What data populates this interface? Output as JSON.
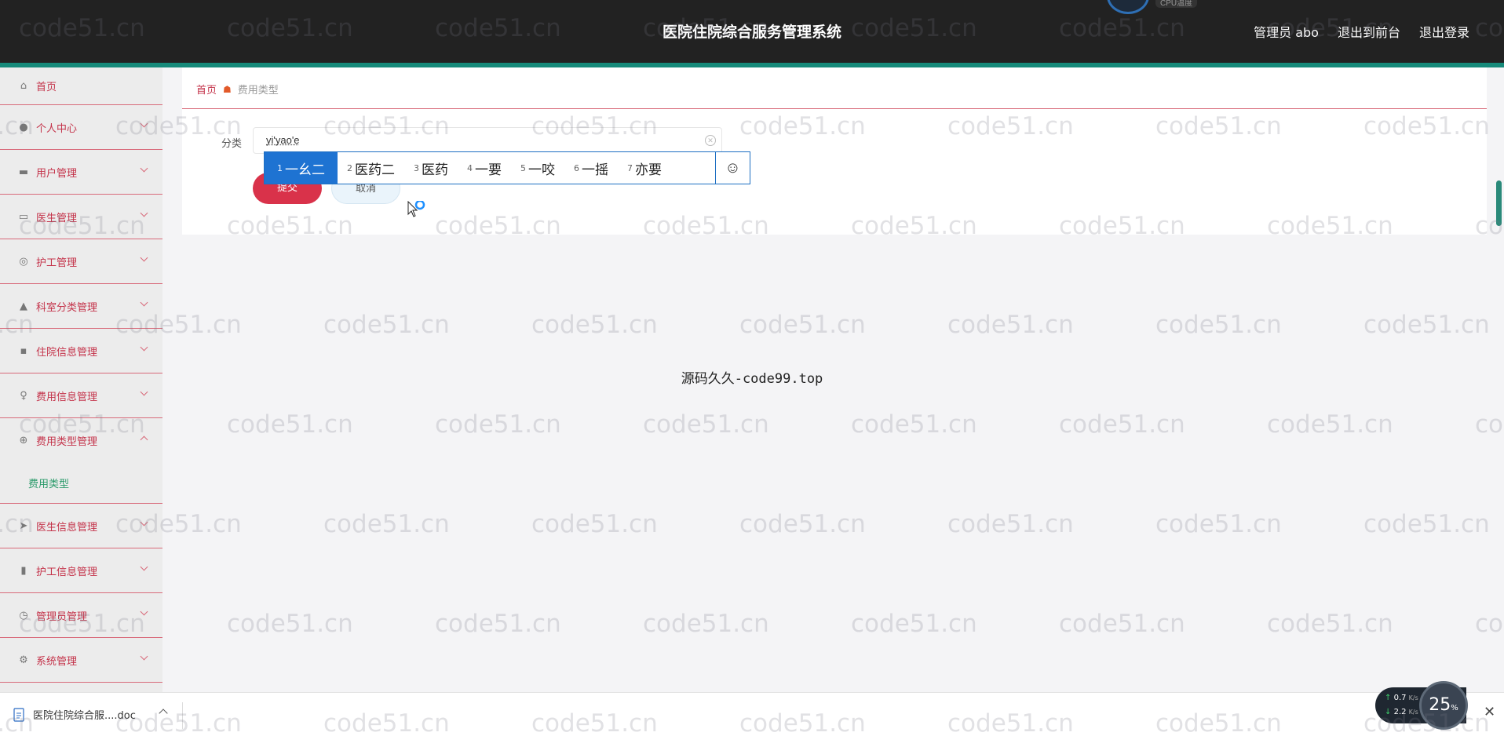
{
  "header": {
    "title": "医院住院综合服务管理系统",
    "user": "管理员 abo",
    "front_link": "退出到前台",
    "logout_link": "退出登录",
    "cpu_label": "CPU温度"
  },
  "sidebar": {
    "items": [
      {
        "label": "首页",
        "icon": "home-icon",
        "glyph": "⌂"
      },
      {
        "label": "个人中心",
        "icon": "user-icon",
        "glyph": "●"
      },
      {
        "label": "用户管理",
        "icon": "users-icon",
        "glyph": "▬"
      },
      {
        "label": "医生管理",
        "icon": "monitor-icon",
        "glyph": "▭"
      },
      {
        "label": "护工管理",
        "icon": "gauge-icon",
        "glyph": "◎"
      },
      {
        "label": "科室分类管理",
        "icon": "person-icon",
        "glyph": "▲"
      },
      {
        "label": "住院信息管理",
        "icon": "chat-icon",
        "glyph": "▪"
      },
      {
        "label": "费用信息管理",
        "icon": "mic-icon",
        "glyph": "♀"
      },
      {
        "label": "费用类型管理",
        "icon": "globe-icon",
        "glyph": "⊕"
      },
      {
        "label": "医生信息管理",
        "icon": "send-icon",
        "glyph": "➤"
      },
      {
        "label": "护工信息管理",
        "icon": "bar-chart-icon",
        "glyph": "▮"
      },
      {
        "label": "管理员管理",
        "icon": "clock-icon",
        "glyph": "◷"
      },
      {
        "label": "系统管理",
        "icon": "settings-icon",
        "glyph": "⚙"
      }
    ],
    "sub_item": "费用类型"
  },
  "breadcrumb": {
    "home": "首页",
    "current": "费用类型"
  },
  "form": {
    "label": "分类",
    "value": "yi'yao'e",
    "submit": "提交",
    "cancel": "取消"
  },
  "ime": {
    "candidates": [
      {
        "num": "1",
        "text": "一幺二"
      },
      {
        "num": "2",
        "text": "医药二"
      },
      {
        "num": "3",
        "text": "医药"
      },
      {
        "num": "4",
        "text": "一要"
      },
      {
        "num": "5",
        "text": "一咬"
      },
      {
        "num": "6",
        "text": "一摇"
      },
      {
        "num": "7",
        "text": "亦要"
      }
    ],
    "emoji": "☺"
  },
  "center_watermark": "源码久久-code99.top",
  "watermark_text": "code51.cn",
  "download_bar": {
    "filename": "医院住院综合服....doc",
    "close": "✕"
  },
  "net_widget": {
    "up": "0.7",
    "down": "2.2",
    "unit": "K/s",
    "percent": "25",
    "percent_unit": "%"
  }
}
